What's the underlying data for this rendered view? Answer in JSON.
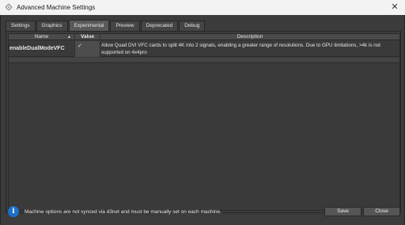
{
  "window": {
    "title": "Advanced Machine Settings",
    "close_glyph": "✕"
  },
  "tabs": [
    {
      "label": "Settings",
      "active": false
    },
    {
      "label": "Graphics",
      "active": false
    },
    {
      "label": "Experimental",
      "active": true
    },
    {
      "label": "Preview",
      "active": false
    },
    {
      "label": "Deprecated",
      "active": false
    },
    {
      "label": "Debug",
      "active": false
    }
  ],
  "table": {
    "columns": {
      "name": "Name",
      "value": "Value",
      "description": "Description"
    },
    "rows": [
      {
        "name": "enableDualModeVFC",
        "checked": true,
        "check_glyph": "✓",
        "description": "Allow Quad DVI VFC cards to split 4K into 2 signals, enabling a greater range of resolutions. Due to GPU limitations, >4k is not supported on 4x4pro"
      }
    ]
  },
  "footer": {
    "info_glyph": "i",
    "message": "Machine options are not synced via d3net and must be manually set on each machine.",
    "save_label": "Save",
    "close_label": "Close"
  },
  "colors": {
    "accent": "#1e6fc8",
    "background": "#3c3c3c"
  }
}
